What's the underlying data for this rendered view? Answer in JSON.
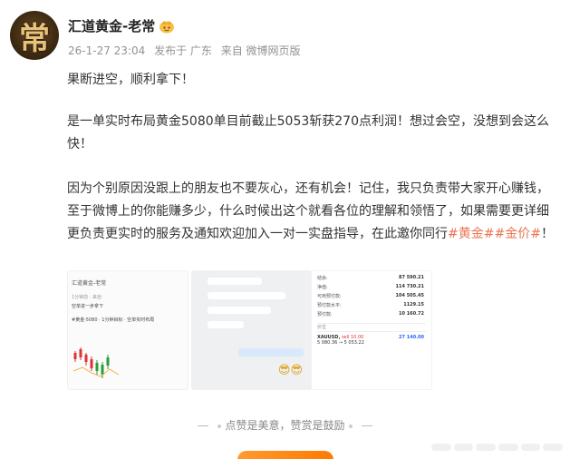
{
  "author": {
    "avatar_glyph": "常",
    "name": "汇道黄金-老常",
    "badge_icon": "crown-badge-icon",
    "time": "26-1-27 23:04",
    "source_prefix": "发布于 广东",
    "source": "来自 微博网页版"
  },
  "post": {
    "para1": "果断进空，顺利拿下！",
    "para2": "是一单实时布局黄金5080单目前截止5053斩获270点利润！想过会空，没想到会这么快！",
    "para3_main": "因为个别原因没跟上的朋友也不要灰心，还有机会！记住，我只负责带大家开心赚钱，至于微博上的你能赚多少，什么时候出这个就看各位的理解和领悟了，如果需要更详细更负责更实时的服务及通知欢迎加入一对一实盘指导，在此邀你同行",
    "topic1": "#黄金#",
    "topic2": "#金价#",
    "para3_end": "！"
  },
  "thumbs": {
    "t1": {
      "title": "汇道黄金-老常",
      "meta": "1分钟前 · 来自",
      "line1": "空单进一步拿下",
      "line2": "#黄金·5080 · 1分钟目标 · 空单实时布局"
    },
    "t2": {
      "emoji": "😎😎"
    },
    "t3": {
      "rows": [
        {
          "label": "结余:",
          "value": "87 590.21"
        },
        {
          "label": "净值:",
          "value": "114 730.21"
        },
        {
          "label": "可用预付款:",
          "value": "104 505.45"
        },
        {
          "label": "预付款水平:",
          "value": "1129.15"
        },
        {
          "label": "预付款:",
          "value": "10 160.72"
        }
      ],
      "section": "价位",
      "pos_symbol": "XAUUSD,",
      "pos_side": "sell 10.00",
      "pos_prices": "5 080.36 → 5 053.22",
      "pos_profit": "27 140.00"
    }
  },
  "footer": {
    "note": "点赞是美意，赞赏是鼓励"
  },
  "colors": {
    "topic": "#eb7350",
    "accent": "#ff8200",
    "meta": "#939393"
  }
}
